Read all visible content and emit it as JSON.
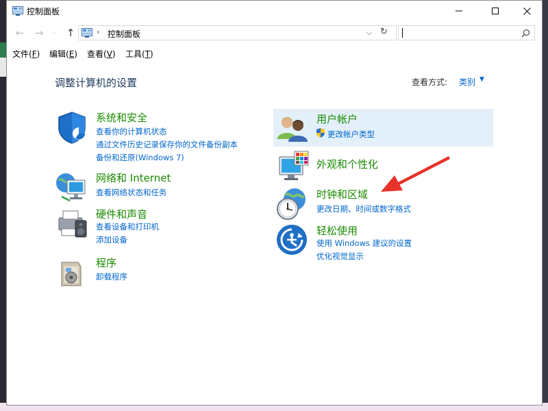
{
  "window": {
    "title": "控制面板",
    "buttons": {
      "minimize": "—",
      "maximize": "☐",
      "close": "✕"
    }
  },
  "nav": {
    "back": "←",
    "forward": "→",
    "dropdown": "⌵",
    "up": "↑",
    "address_separator": "›",
    "address": "控制面板",
    "address_dropdown": "⌵",
    "refresh": "↻",
    "search_value": ""
  },
  "menu": [
    {
      "label": "文件",
      "accel": "F"
    },
    {
      "label": "编辑",
      "accel": "E"
    },
    {
      "label": "查看",
      "accel": "V"
    },
    {
      "label": "工具",
      "accel": "T"
    }
  ],
  "main": {
    "heading": "调整计算机的设置",
    "view_by_label": "查看方式:",
    "view_by_value": "类别",
    "view_by_caret": "▼"
  },
  "categories": {
    "system_security": {
      "title": "系统和安全",
      "links": [
        "查看你的计算机状态",
        "通过文件历史记录保存你的文件备份副本",
        "备份和还原(Windows 7)"
      ]
    },
    "network": {
      "title": "网络和 Internet",
      "links": [
        "查看网络状态和任务"
      ]
    },
    "hardware": {
      "title": "硬件和声音",
      "links": [
        "查看设备和打印机",
        "添加设备"
      ]
    },
    "programs": {
      "title": "程序",
      "links": [
        "卸载程序"
      ]
    },
    "user_accounts": {
      "title": "用户帐户",
      "links": [
        "更改帐户类型"
      ]
    },
    "appearance": {
      "title": "外观和个性化",
      "links": []
    },
    "clock_region": {
      "title": "时钟和区域",
      "links": [
        "更改日期、时间或数字格式"
      ]
    },
    "ease_of_access": {
      "title": "轻松使用",
      "links": [
        "使用 Windows 建议的设置",
        "优化视觉显示"
      ]
    }
  },
  "annotation": {
    "color": "#e8332a",
    "icon": "arrow-icon"
  },
  "colors": {
    "category_title": "#1a8a00",
    "link": "#0066cc",
    "heading": "#1e395b",
    "highlight": "#e3f0fa"
  }
}
